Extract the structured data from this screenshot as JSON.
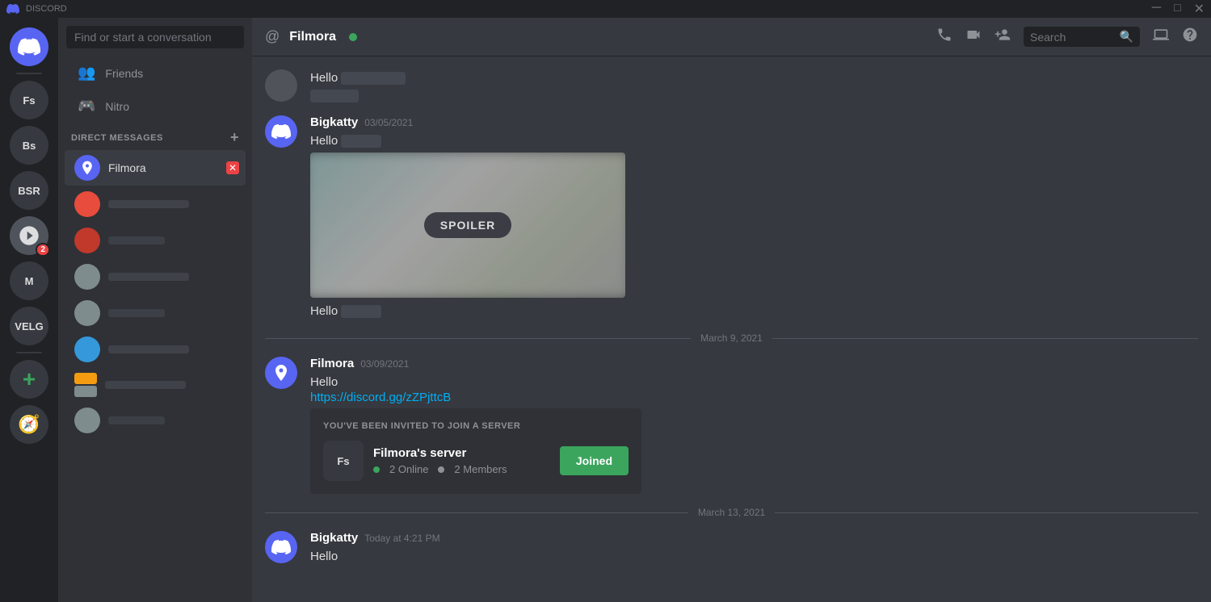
{
  "titleBar": {
    "appName": "DISCORD",
    "controls": [
      "minimize",
      "maximize",
      "close"
    ]
  },
  "serverSidebar": {
    "icons": [
      {
        "id": "discord-home",
        "label": "Discord Home",
        "type": "discord",
        "symbol": "⬡"
      },
      {
        "id": "Fs",
        "label": "Filmora's server",
        "type": "text",
        "text": "Fs"
      },
      {
        "id": "Bs",
        "label": "Bs server",
        "type": "text",
        "text": "Bs"
      },
      {
        "id": "BSR",
        "label": "BSR",
        "type": "text",
        "text": "BSR"
      },
      {
        "id": "server4",
        "label": "Server 4",
        "type": "image",
        "hasBadge": true,
        "badge": "2"
      },
      {
        "id": "M",
        "label": "M server",
        "type": "text",
        "text": "M"
      },
      {
        "id": "VELG",
        "label": "VELG",
        "type": "text",
        "text": "VELG"
      },
      {
        "id": "add",
        "label": "Add a Server",
        "type": "add",
        "symbol": "+"
      },
      {
        "id": "explore",
        "label": "Explore Public Servers",
        "type": "explore",
        "symbol": "🧭"
      }
    ]
  },
  "dmSidebar": {
    "searchPlaceholder": "Find or start a conversation",
    "navItems": [
      {
        "id": "friends",
        "label": "Friends",
        "icon": "👤"
      },
      {
        "id": "nitro",
        "label": "Nitro",
        "icon": "🎮"
      }
    ],
    "sectionHeader": "DIRECT MESSAGES",
    "addButton": "+",
    "dmItems": [
      {
        "id": "filmora",
        "label": "Filmora",
        "active": true,
        "hasCloseBtn": true,
        "avatarType": "filmora-icon"
      },
      {
        "id": "dm2",
        "label": "",
        "blurred": true,
        "color": "#e74c3c"
      },
      {
        "id": "dm3",
        "label": "",
        "blurred": true,
        "color": "#c0392b"
      },
      {
        "id": "dm4",
        "label": "",
        "blurred": true,
        "color": "#7f8c8d"
      },
      {
        "id": "dm5",
        "label": "",
        "blurred": true,
        "color": "#7f8c8d"
      },
      {
        "id": "dm6",
        "label": "",
        "blurred": true,
        "color": "#3498db"
      },
      {
        "id": "dm7",
        "label": "",
        "blurred": true,
        "color": "#7f8c8d",
        "hasColorBar": "#f39c12"
      },
      {
        "id": "dm8",
        "label": "",
        "blurred": true,
        "color": "#7f8c8d"
      }
    ]
  },
  "chatHeader": {
    "icon": "@",
    "username": "Filmora",
    "onlineStatus": "online",
    "actions": {
      "phoneIcon": "📞",
      "videoIcon": "🎥",
      "addFriendIcon": "👤+",
      "searchLabel": "Search",
      "screenShareIcon": "🖥",
      "helpIcon": "?"
    }
  },
  "messages": [
    {
      "id": "msg1",
      "author": "",
      "timestamp": "",
      "avatar": {
        "type": "blurred",
        "color": "#8e9297"
      },
      "content": [
        {
          "type": "text",
          "value": "Hello"
        },
        {
          "type": "blurred"
        }
      ]
    },
    {
      "id": "msg2",
      "author": "Bigkatty",
      "timestamp": "03/05/2021",
      "avatar": {
        "type": "discord",
        "color": "#5865f2"
      },
      "content": [
        {
          "type": "text-blurred",
          "prefix": "Hello"
        },
        {
          "type": "spoiler-image"
        }
      ],
      "extraText": "Hello",
      "hasExtraBlurred": true
    },
    {
      "id": "date-divider-1",
      "type": "date-divider",
      "date": "March 9, 2021"
    },
    {
      "id": "msg3",
      "author": "Filmora",
      "timestamp": "03/09/2021",
      "avatar": {
        "type": "filmora-icon"
      },
      "content": [
        {
          "type": "text",
          "value": "Hello"
        },
        {
          "type": "link",
          "value": "https://discord.gg/zZPjttcB"
        }
      ],
      "hasInviteCard": true,
      "inviteCard": {
        "title": "YOU'VE BEEN INVITED TO JOIN A SERVER",
        "serverIconText": "Fs",
        "serverName": "Filmora's server",
        "onlineCount": "2 Online",
        "memberCount": "2 Members",
        "joinBtnLabel": "Joined"
      }
    },
    {
      "id": "date-divider-2",
      "type": "date-divider",
      "date": "March 13, 2021"
    },
    {
      "id": "msg4",
      "author": "Bigkatty",
      "timestamp": "Today at 4:21 PM",
      "avatar": {
        "type": "discord",
        "color": "#5865f2"
      },
      "content": [
        {
          "type": "text",
          "value": "Hello"
        }
      ]
    }
  ],
  "icons": {
    "phone": "📞",
    "video": "📹",
    "addFriend": "➕",
    "search": "🔍",
    "screen": "🖥️",
    "help": "❓",
    "friends": "👥",
    "nitro": "🎮"
  }
}
